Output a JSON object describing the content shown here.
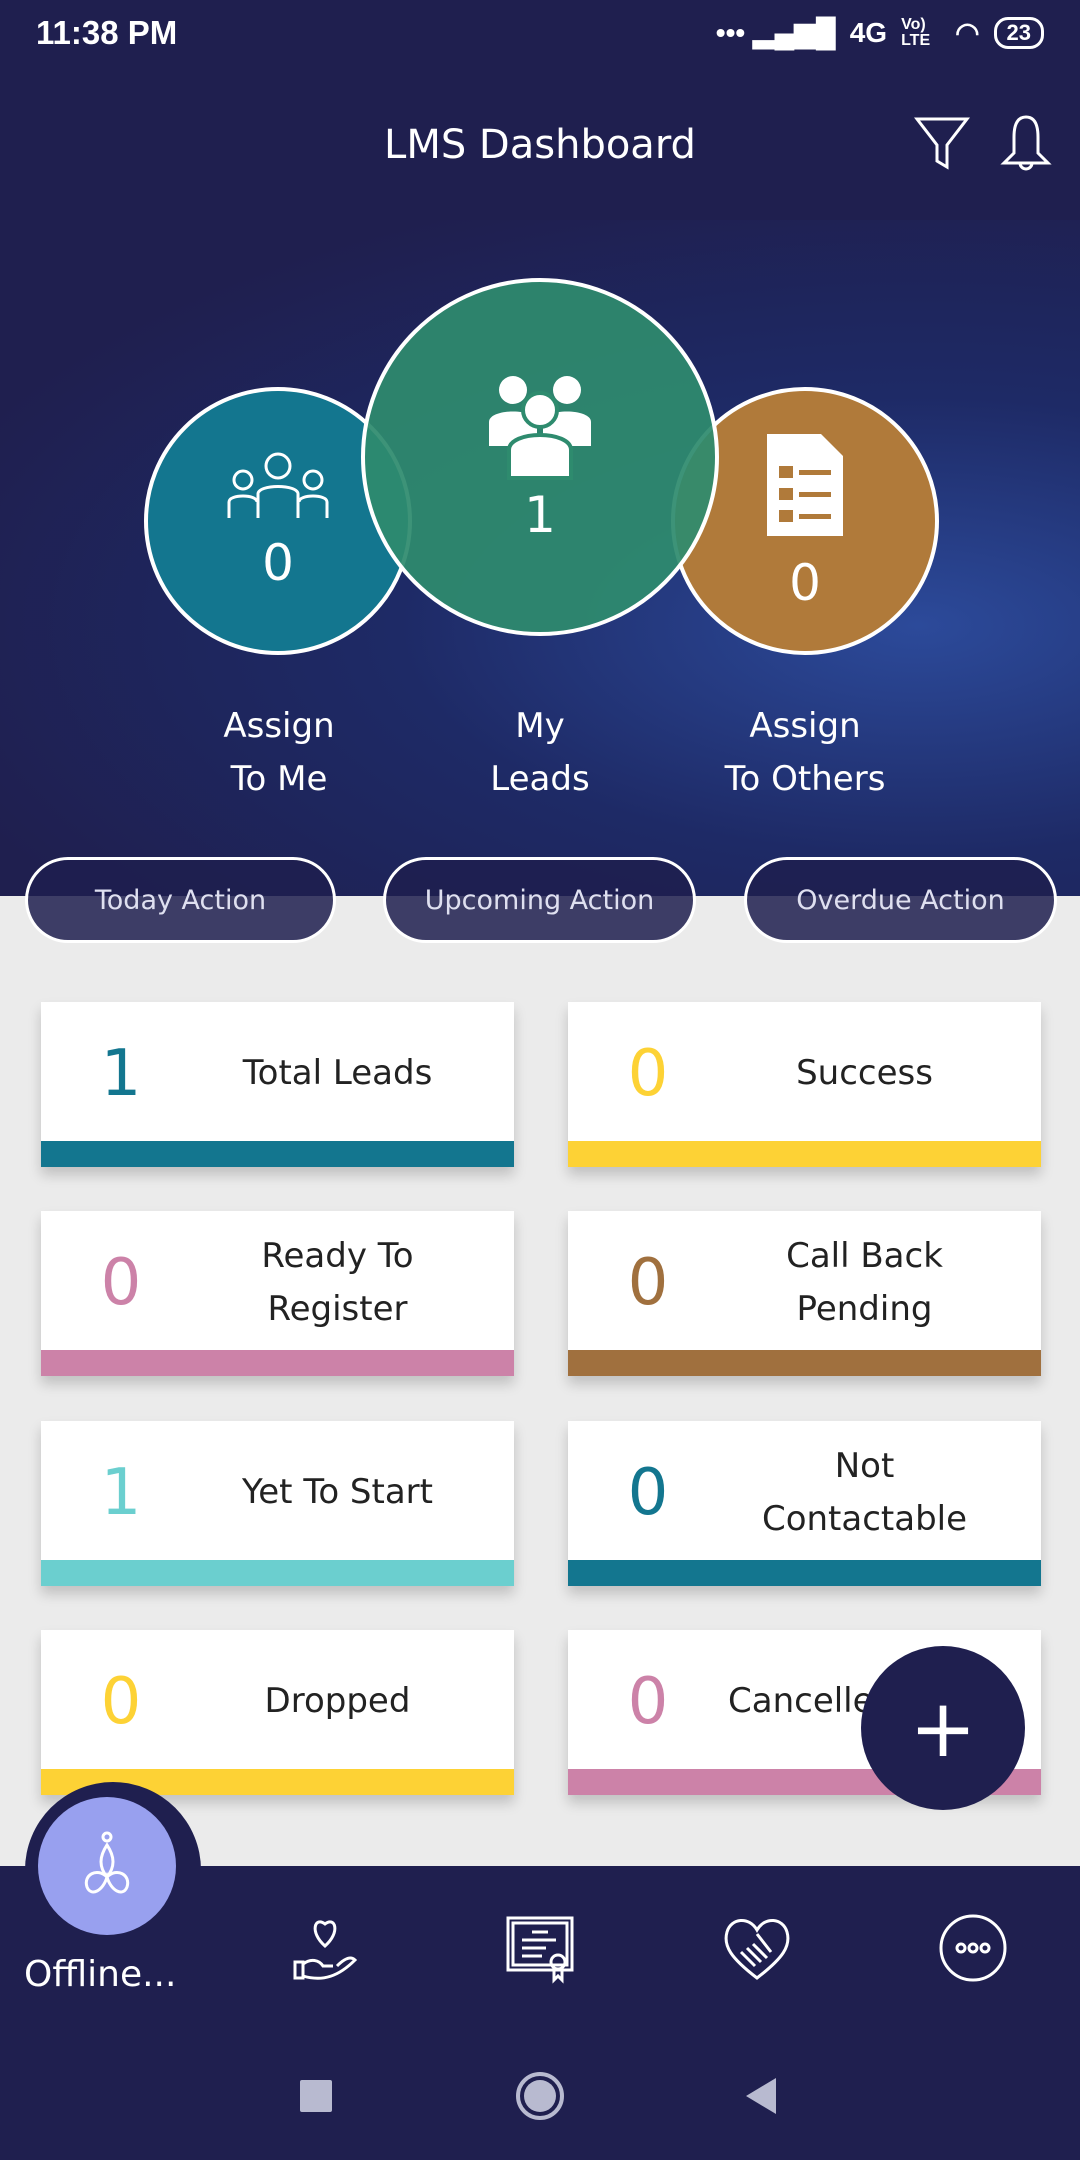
{
  "status_bar": {
    "time": "11:38 PM",
    "network": "4G",
    "volte": "Vo) LTE",
    "battery": "23"
  },
  "header": {
    "title": "LMS Dashboard",
    "icons": [
      "filter-icon",
      "bell-icon"
    ]
  },
  "summary": [
    {
      "label_1": "Assign",
      "label_2": "To Me",
      "count": "0",
      "color": "#13768f",
      "icon": "team-icon"
    },
    {
      "label_1": "My",
      "label_2": "Leads",
      "count": "1",
      "color": "#2e8b6e",
      "icon": "group-icon"
    },
    {
      "label_1": "Assign",
      "label_2": "To Others",
      "count": "0",
      "color": "#b07a3a",
      "icon": "document-icon"
    }
  ],
  "actions": [
    "Today Action",
    "Upcoming Action",
    "Overdue Action"
  ],
  "cards": [
    {
      "count": "1",
      "label": "Total Leads",
      "color": "#13768f"
    },
    {
      "count": "0",
      "label": "Success",
      "color": "#fdd235"
    },
    {
      "count": "0",
      "label": "Ready To Register",
      "color": "#cc82a8"
    },
    {
      "count": "0",
      "label": "Call Back Pending",
      "color": "#a0703e"
    },
    {
      "count": "1",
      "label": "Yet To Start",
      "color": "#6bcfcf"
    },
    {
      "count": "0",
      "label": "Not Contactable",
      "color": "#13768f"
    },
    {
      "count": "0",
      "label": "Dropped",
      "color": "#fdd235"
    },
    {
      "count": "0",
      "label": "Cancelle",
      "color": "#cc82a8"
    }
  ],
  "fab": "+",
  "bottom_nav": {
    "active_label": "Offline...",
    "items": [
      "meditation-icon",
      "hand-heart-icon",
      "certificate-icon",
      "handshake-heart-icon",
      "more-icon"
    ]
  }
}
